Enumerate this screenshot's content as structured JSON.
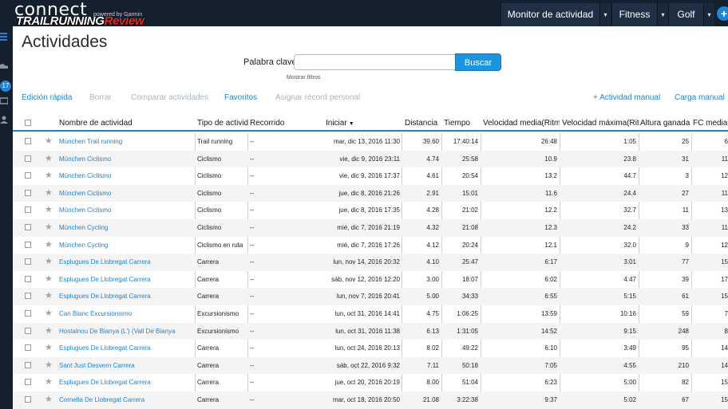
{
  "brand": {
    "logo": "connect",
    "powered_by": "powered by Garmin",
    "watermark_part1": "TRAILRUNNING",
    "watermark_part2": "Review"
  },
  "nav": {
    "monitor": "Monitor de actividad",
    "fitness": "Fitness",
    "golf": "Golf",
    "caret": "▾",
    "plus": "+"
  },
  "sidebar": {
    "badge": "17"
  },
  "page": {
    "title": "Actividades"
  },
  "search": {
    "label": "Palabra clave:",
    "value": "",
    "placeholder": "",
    "button": "Buscar",
    "filters_link": "Mostrar filtros"
  },
  "toolbar": {
    "quick_edit": "Edición rápida",
    "delete": "Borrar",
    "compare": "Comparar actividades",
    "favorites": "Favoritos",
    "assign_record": "Asignar récord personal",
    "manual_activity": "+ Actividad manual",
    "upload_manual": "Carga manual"
  },
  "table": {
    "headers": {
      "name": "Nombre de actividad",
      "type": "Tipo de actividad",
      "route": "Recorrido",
      "start": "Iniciar",
      "distance": "Distancia",
      "time": "Tiempo",
      "avg_speed": "Velocidad media(Ritmo",
      "max_speed": "Velocidad máxima(Ritm",
      "elevation": "Altura ganada",
      "hr_avg": "FC media"
    },
    "sort_arrow": "▼",
    "rows": [
      {
        "name": "München Trail running",
        "type": "Trail running",
        "route": "--",
        "start": "mar, dic 13, 2016 11:30",
        "distance": "39.60",
        "time": "17:40:14",
        "avg": "26:48",
        "max": "1:05",
        "elev": "25",
        "hr": "6"
      },
      {
        "name": "München Ciclismo",
        "type": "Ciclismo",
        "route": "--",
        "start": "vie, dic 9, 2016 23:11",
        "distance": "4.74",
        "time": "25:58",
        "avg": "10.9",
        "max": "23.8",
        "elev": "31",
        "hr": "11"
      },
      {
        "name": "München Ciclismo",
        "type": "Ciclismo",
        "route": "--",
        "start": "vie, dic 9, 2016 17:37",
        "distance": "4.61",
        "time": "20:54",
        "avg": "13.2",
        "max": "44.7",
        "elev": "3",
        "hr": "12"
      },
      {
        "name": "München Ciclismo",
        "type": "Ciclismo",
        "route": "--",
        "start": "jue, dic 8, 2016 21:26",
        "distance": "2.91",
        "time": "15:01",
        "avg": "11.6",
        "max": "24.4",
        "elev": "27",
        "hr": "11"
      },
      {
        "name": "München Ciclismo",
        "type": "Ciclismo",
        "route": "--",
        "start": "jue, dic 8, 2016 17:35",
        "distance": "4.28",
        "time": "21:02",
        "avg": "12.2",
        "max": "32.7",
        "elev": "11",
        "hr": "13"
      },
      {
        "name": "München Cycling",
        "type": "Ciclismo",
        "route": "--",
        "start": "mié, dic 7, 2016 21:19",
        "distance": "4.32",
        "time": "21:08",
        "avg": "12.3",
        "max": "24.2",
        "elev": "33",
        "hr": "11"
      },
      {
        "name": "München Cycling",
        "type": "Ciclismo en ruta",
        "route": "--",
        "start": "mié, dic 7, 2016 17:26",
        "distance": "4.12",
        "time": "20:24",
        "avg": "12.1",
        "max": "32.0",
        "elev": "9",
        "hr": "12"
      },
      {
        "name": "Esplugues De Llobregat Carrera",
        "type": "Carrera",
        "route": "--",
        "start": "lun, nov 14, 2016 20:32",
        "distance": "4.10",
        "time": "25:47",
        "avg": "6:17",
        "max": "3:01",
        "elev": "77",
        "hr": "15"
      },
      {
        "name": "Esplugues De Llobregat Carrera",
        "type": "Carrera",
        "route": "--",
        "start": "sáb, nov 12, 2016 12:20",
        "distance": "3.00",
        "time": "18:07",
        "avg": "6:02",
        "max": "4:47",
        "elev": "39",
        "hr": "17"
      },
      {
        "name": "Esplugues De Llobregat Carrera",
        "type": "Carrera",
        "route": "--",
        "start": "lun, nov 7, 2016 20:41",
        "distance": "5.00",
        "time": "34:33",
        "avg": "6:55",
        "max": "5:15",
        "elev": "61",
        "hr": "15"
      },
      {
        "name": "Can Blanc Excursionismo",
        "type": "Excursionismo",
        "route": "--",
        "start": "lun, oct 31, 2016 14:41",
        "distance": "4.75",
        "time": "1:06:25",
        "avg": "13:59",
        "max": "10:16",
        "elev": "59",
        "hr": "7"
      },
      {
        "name": "Hostalnou De Bianya (L') (Vall De Bianya",
        "type": "Excursionismo",
        "route": "--",
        "start": "lun, oct 31, 2016 11:38",
        "distance": "6.13",
        "time": "1:31:05",
        "avg": "14:52",
        "max": "9:15",
        "elev": "248",
        "hr": "8"
      },
      {
        "name": "Esplugues De Llobregat Carrera",
        "type": "Carrera",
        "route": "--",
        "start": "lun, oct 24, 2016 20:13",
        "distance": "8.02",
        "time": "49:22",
        "avg": "6:10",
        "max": "3:49",
        "elev": "95",
        "hr": "14"
      },
      {
        "name": "Sant Just Desvern Carrera",
        "type": "Carrera",
        "route": "--",
        "start": "sáb, oct 22, 2016 9:32",
        "distance": "7.11",
        "time": "50:18",
        "avg": "7:05",
        "max": "4:55",
        "elev": "210",
        "hr": "14"
      },
      {
        "name": "Esplugues De Llobregat Carrera",
        "type": "Carrera",
        "route": "--",
        "start": "jue, oct 20, 2016 20:19",
        "distance": "8.00",
        "time": "51:04",
        "avg": "6:23",
        "max": "5:00",
        "elev": "82",
        "hr": "15"
      },
      {
        "name": "Cornella De Llobregat Carrera",
        "type": "Carrera",
        "route": "--",
        "start": "mar, oct 18, 2016 20:50",
        "distance": "21.08",
        "time": "3:22:38",
        "avg": "9:37",
        "max": "5:02",
        "elev": "67",
        "hr": "15"
      }
    ]
  }
}
